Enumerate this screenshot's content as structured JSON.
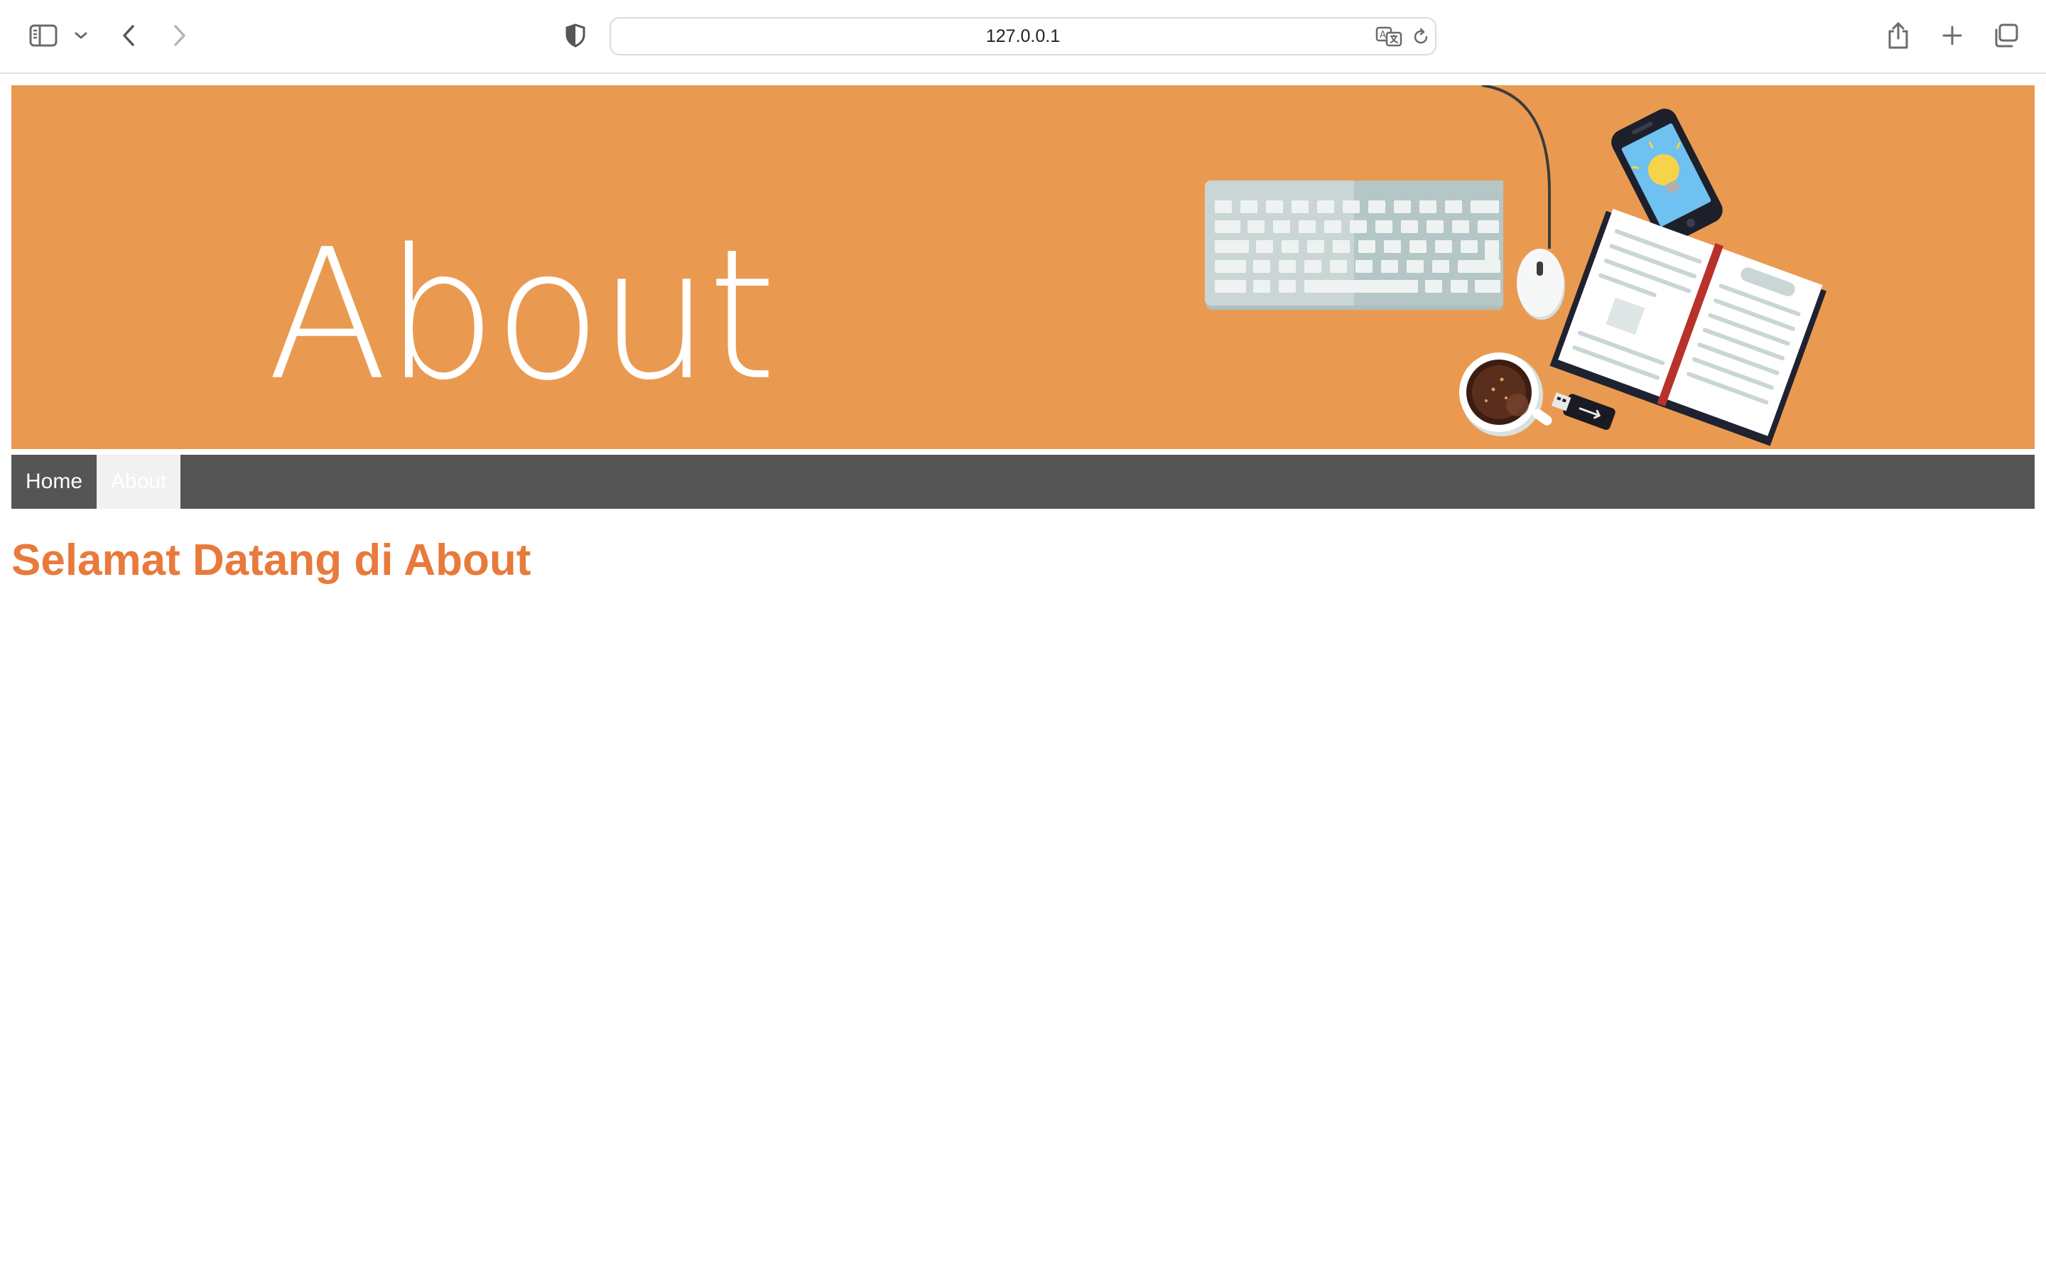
{
  "browser": {
    "url": "127.0.0.1",
    "icons": [
      "sidebar-icon",
      "chevron-down-icon",
      "back-icon",
      "forward-icon",
      "shield-icon",
      "translate-icon",
      "reload-icon",
      "share-icon",
      "new-tab-icon",
      "tabs-overview-icon"
    ]
  },
  "banner": {
    "title": "About",
    "background_color": "#e99a50",
    "illustration_icons": [
      "keyboard-icon",
      "mouse-icon",
      "smartphone-icon",
      "lightbulb-icon",
      "book-icon",
      "coffee-cup-icon",
      "usb-drive-icon"
    ]
  },
  "nav": {
    "items": [
      {
        "label": "Home",
        "active": false
      },
      {
        "label": "About",
        "active": true
      }
    ],
    "background_color": "#555555",
    "active_color": "#f1f1f1"
  },
  "main": {
    "heading": "Selamat Datang di About",
    "heading_color": "#e87a3c"
  }
}
